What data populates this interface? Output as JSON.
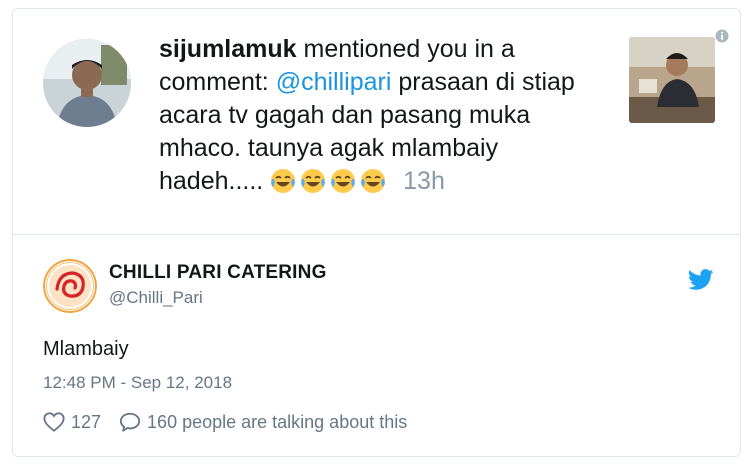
{
  "notification": {
    "username": "sijumlamuk",
    "action_text": " mentioned you in a comment: ",
    "mention": "@chillipari",
    "comment_text": " prasaan di stiap acara tv gagah dan pasang muka mhaco. taunya agak mlambaiy hadeh.....",
    "emoji_name": "face-with-tears-of-joy",
    "time": "13h"
  },
  "tweet": {
    "display_name": "CHILLI PARI CATERING",
    "handle": "@Chilli_Pari",
    "text": "Mlambaiy",
    "timestamp": "12:48 PM - Sep 12, 2018",
    "likes": "127",
    "talking": "160 people are talking about this"
  },
  "icons": {
    "info": "info-icon",
    "twitter": "twitter-bird-icon",
    "like": "heart-icon",
    "reply": "speech-bubble-icon"
  },
  "colors": {
    "mention": "#1b95e0",
    "twitter_blue": "#1da1f2",
    "muted": "#657786",
    "border": "#e1e8ed"
  }
}
